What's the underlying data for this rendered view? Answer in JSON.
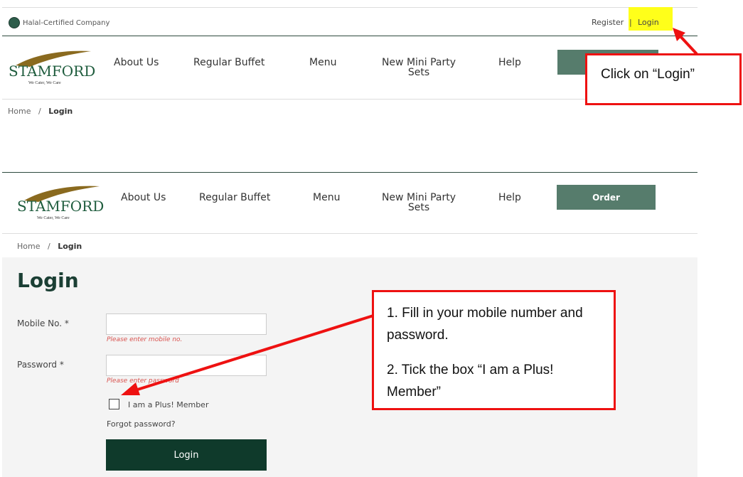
{
  "top": {
    "halal_text": "Halal-Certified Company",
    "register": "Register",
    "separator": "|",
    "login": "Login"
  },
  "brand": {
    "name": "STAMFORD",
    "tagline": "We Cater, We Care"
  },
  "nav": {
    "about": "About Us",
    "buffet": "Regular Buffet",
    "menu": "Menu",
    "mini_line1": "New Mini Party",
    "mini_line2": "Sets",
    "help": "Help",
    "order": "Order"
  },
  "breadcrumb": {
    "home": "Home",
    "sep": "/",
    "current": "Login"
  },
  "login_form": {
    "title": "Login",
    "mobile_label": "Mobile No. *",
    "mobile_error": "Please enter mobile no.",
    "password_label": "Password *",
    "password_error": "Please enter password",
    "plus_member": "I am a Plus! Member",
    "forgot": "Forgot password?",
    "submit": "Login"
  },
  "callouts": {
    "first": "Click on “Login”",
    "second_line1": "1. Fill in your mobile number and password.",
    "second_line2": "2. Tick the box “I am a Plus! Member”"
  },
  "colors": {
    "brand_green": "#1b3f34",
    "order_btn": "#567c6c",
    "highlight": "#ffff1a",
    "callout_red": "#ee1111"
  }
}
